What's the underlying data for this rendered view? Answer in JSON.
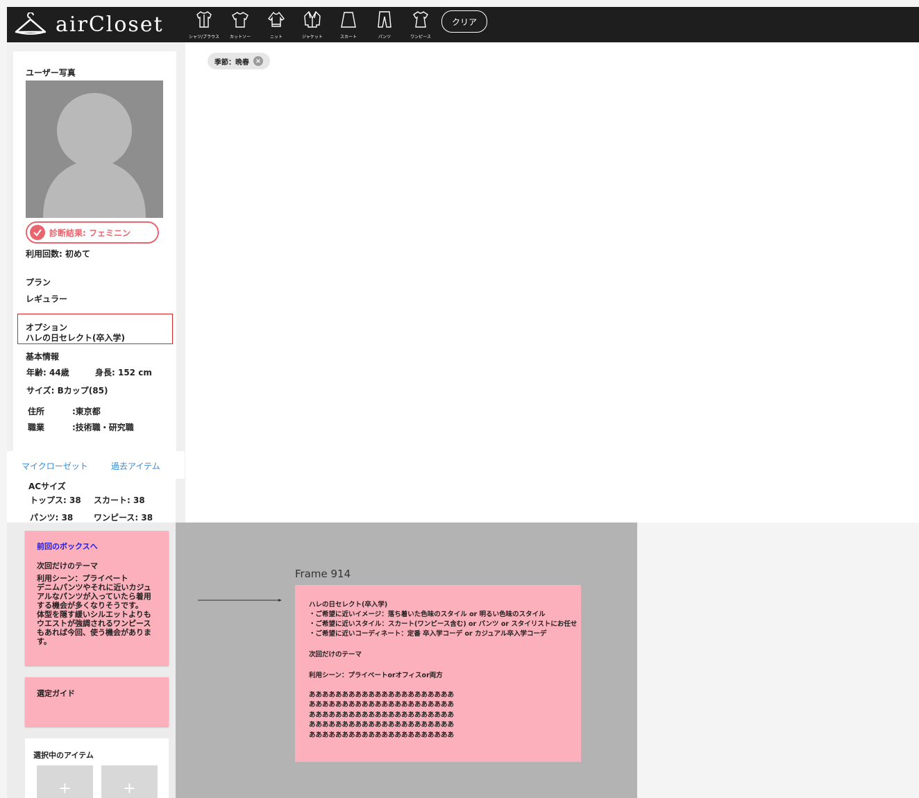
{
  "header": {
    "logo_text": "airCloset",
    "categories": [
      {
        "label": "シャツ/ブラウス",
        "icon": "shirt-icon"
      },
      {
        "label": "カットソー",
        "icon": "tshirt-icon"
      },
      {
        "label": "ニット",
        "icon": "knit-icon"
      },
      {
        "label": "ジャケット",
        "icon": "jacket-icon"
      },
      {
        "label": "スカート",
        "icon": "skirt-icon"
      },
      {
        "label": "パンツ",
        "icon": "pants-icon"
      },
      {
        "label": "ワンピース",
        "icon": "dress-icon"
      }
    ],
    "clear_label": "クリア"
  },
  "filter_chip": {
    "label": "季節：晩春"
  },
  "profile": {
    "photo_title": "ユーザー写真",
    "diagnosis": "診断結果: フェミニン",
    "usage": "利用回数: 初めて",
    "plan_label": "プラン",
    "plan_value": "レギュラー",
    "option_label": "オプション",
    "option_value": "ハレの日セレクト(卒入学)",
    "basic_label": "基本情報",
    "age": "年齢: 44歳",
    "height": "身長: 152 cm",
    "size": "サイズ: Bカップ(85)",
    "address_label": "住所",
    "address_value": ":東京都",
    "job_label": "職業",
    "job_value": ":技術職・研究職"
  },
  "tabs": {
    "micro": "マイクローゼット",
    "past": "過去アイテム"
  },
  "ac_size": {
    "title": "ACサイズ",
    "tops": "トップス: 38",
    "skirt": "スカート: 38",
    "pants": "パンツ: 38",
    "onepiece": "ワンピース: 38"
  },
  "prev_box": {
    "link": "前回のボックスへ",
    "theme_title": "次回だけのテーマ",
    "lines": [
      "利用シーン：プライベート",
      "デニムパンツやそれに近いカジュ",
      "アルなパンツが入っていたら着用",
      "する機会が多くなりそうです。",
      "体型を隠す緩いシルエットよりも",
      "ウエストが強調されるワンピース",
      "もあれば今回、使う機会がありま",
      "す。"
    ]
  },
  "guide": {
    "title": "選定ガイド"
  },
  "selected": {
    "title": "選択中のアイテム",
    "slot_label": "+"
  },
  "frame": {
    "label": "Frame 914",
    "title": "ハレの日セレクト(卒入学)",
    "bullets": [
      "・ご希望に近いイメージ：落ち着いた色味のスタイル or 明るい色味のスタイル",
      "・ご希望に近いスタイル：スカート(ワンピース含む) or パンツ or スタイリストにお任せ",
      "・ご希望に近いコーディネート：定番 卒入学コーデ or カジュアル卒入学コーデ"
    ],
    "theme": "次回だけのテーマ",
    "scene": "利用シーン：プライベートorオフィスor両方",
    "filler": [
      "ああああああああああああああああああああああ",
      "ああああああああああああああああああああああ",
      "ああああああああああああああああああああああ",
      "ああああああああああああああああああああああ",
      "ああああああああああああああああああああああ"
    ]
  }
}
